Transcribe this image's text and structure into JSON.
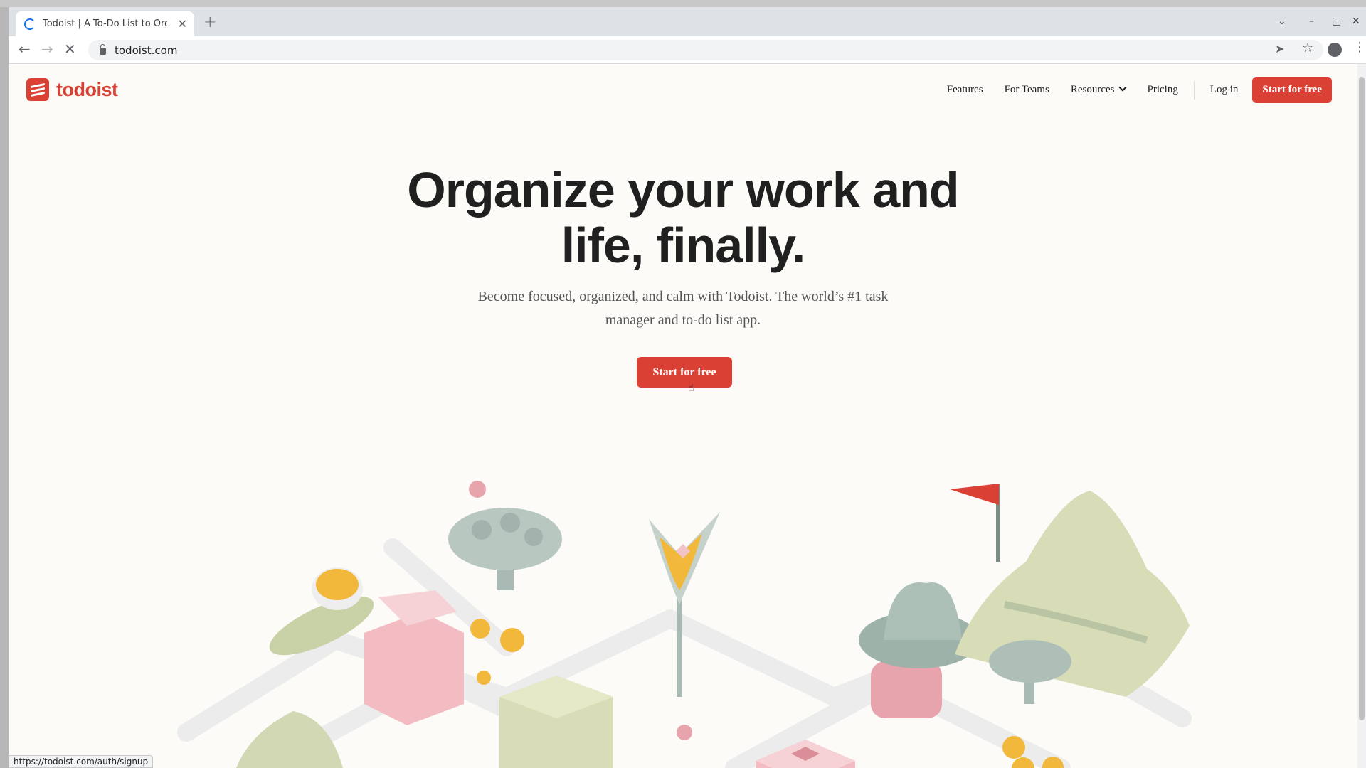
{
  "browser": {
    "tab_title": "Todoist | A To-Do List to Organize Your Work & Life",
    "url": "todoist.com",
    "status_url": "https://todoist.com/auth/signup"
  },
  "header": {
    "logo_text": "todoist",
    "nav": [
      "Features",
      "For Teams",
      "Resources",
      "Pricing",
      "Log in"
    ],
    "cta": "Start for free"
  },
  "hero": {
    "title_line1": "Organize your work and",
    "title_line2": "life, finally.",
    "subtitle_line1": "Become focused, organized, and calm with Todoist. The world’s #1 task",
    "subtitle_line2": "manager and to-do list app.",
    "cta": "Start for free"
  },
  "colors": {
    "brand": "#db4035",
    "page_bg": "#fcfbf8",
    "text": "#202020"
  }
}
